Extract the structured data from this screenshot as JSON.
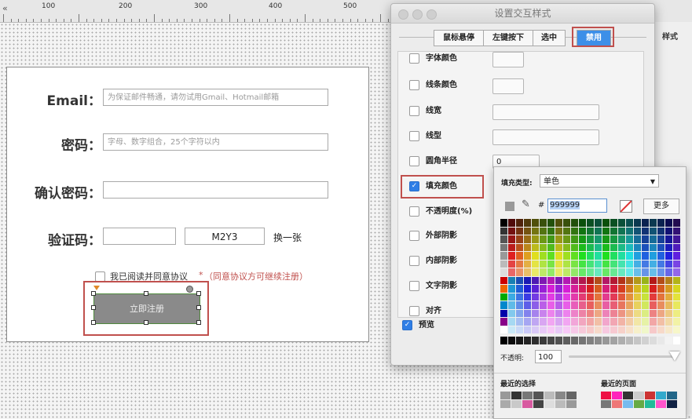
{
  "ruler": {
    "labels": [
      "100",
      "200",
      "300",
      "400",
      "500"
    ],
    "collapse_glyph": "«"
  },
  "form": {
    "email_label": "Email：",
    "email_placeholder": "为保证邮件畅通，请勿试用Gmail、Hotmail邮箱",
    "password_label": "密码：",
    "password_placeholder": "字母、数字组合，25个字符以内",
    "confirm_label": "确认密码：",
    "captcha_label": "验证码：",
    "captcha_code": "M2Y3",
    "captcha_refresh": "换一张",
    "agree_text": "我已阅读并同意协议",
    "agree_star": "*",
    "agree_note": "（同意协议方可继续注册）",
    "submit_label": "立即注册"
  },
  "dialog": {
    "title": "设置交互样式",
    "tabs": [
      "鼠标悬停",
      "左键按下",
      "选中",
      "禁用"
    ],
    "active_tab": "禁用",
    "props": [
      "字体颜色",
      "线条颜色",
      "线宽",
      "线型",
      "圆角半径",
      "填充颜色",
      "不透明度(%)",
      "外部阴影",
      "内部阴影",
      "文字阴影",
      "对齐"
    ],
    "checked_prop": "填充颜色",
    "radius_value": "0",
    "preview_label": "预览"
  },
  "side_panel": {
    "style_tab": "样式"
  },
  "picker": {
    "fill_type_label": "填充类型:",
    "fill_type_value": "单色",
    "hash": "#",
    "hex_value": "999999",
    "more_button": "更多",
    "opacity_label": "不透明:",
    "opacity_value": "100",
    "recent_selection": "最近的选择",
    "recent_page": "最近的页面"
  },
  "colors": {
    "highlight": "#c0504d",
    "button_fill": "#8a8a8a",
    "accent": "#2f7ee6"
  }
}
